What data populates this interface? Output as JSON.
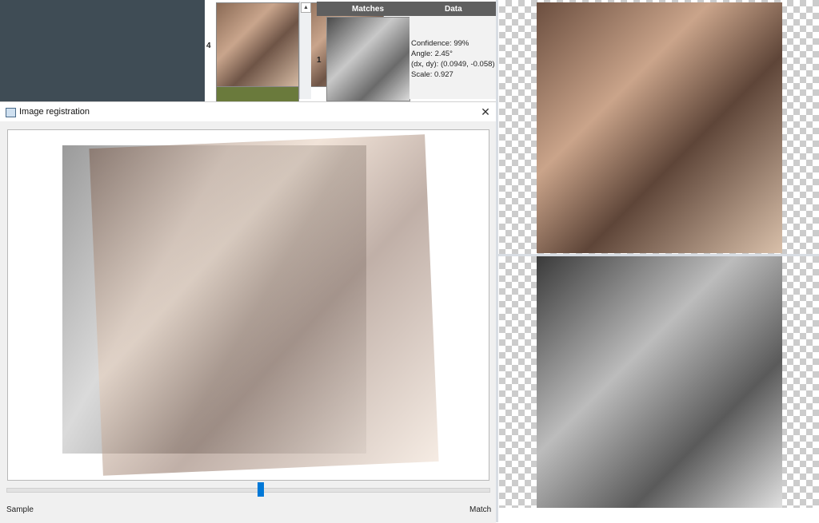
{
  "matches_table": {
    "headers": {
      "matches": "Matches",
      "data": "Data"
    },
    "rows": [
      {
        "index": "4"
      },
      {
        "index": "1",
        "confidence": "Confidence: 99%",
        "angle": "Angle: 2.45°",
        "offset": "(dx, dy): (0.0949, -0.058)",
        "scale": "Scale: 0.927"
      }
    ]
  },
  "dialog": {
    "title": "Image registration",
    "close_glyph": "✕",
    "slider_label_left": "Sample",
    "slider_label_right": "Match",
    "slider_fraction": 0.53
  },
  "icons": [
    "app-icon",
    "close-icon",
    "scroll-up-arrow-icon"
  ],
  "colors": {
    "accent": "#0078d7",
    "dark_panel": "#3f4c55",
    "header_bg": "#5f5f5f"
  }
}
